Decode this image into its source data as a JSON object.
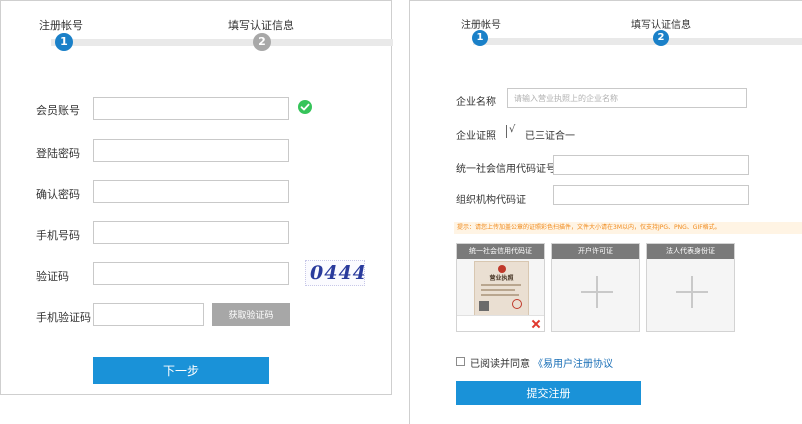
{
  "left": {
    "steps": [
      {
        "label": "注册帐号",
        "number": "1"
      },
      {
        "label": "填写认证信息",
        "number": "2"
      }
    ],
    "fields": {
      "account_label": "会员账号",
      "password_label": "登陆密码",
      "confirm_label": "确认密码",
      "phone_label": "手机号码",
      "captcha_label": "验证码",
      "sms_label": "手机验证码"
    },
    "captcha_text": "0444",
    "get_code_button": "获取验证码",
    "next_button": "下一步"
  },
  "right": {
    "steps": [
      {
        "label": "注册帐号",
        "number": "1"
      },
      {
        "label": "填写认证信息",
        "number": "2"
      }
    ],
    "company_name_label": "企业名称",
    "company_name_placeholder": "请输入营业执照上的企业名称",
    "certificate_label": "企业证照",
    "certificate_value": "已三证合一",
    "credit_code_label": "统一社会信用代码证号",
    "org_code_label": "组织机构代码证",
    "notice": "提示：请您上传加盖公章的证照彩色扫描件，文件大小请在3M以内，仅支持JPG、PNG、GIF格式。",
    "uploads": [
      {
        "title": "统一社会信用代码证"
      },
      {
        "title": "开户许可证"
      },
      {
        "title": "法人代表身份证"
      }
    ],
    "license_title": "营业执照",
    "agree_prefix": "已阅读并同意",
    "agree_link": "《易用户注册协议",
    "submit_button": "提交注册"
  },
  "colors": {
    "primary": "#1a92d8",
    "step_active": "#1a80c8",
    "step_inactive": "#a8a8a8",
    "success": "#36c45a",
    "notice_text": "#f08a1c",
    "notice_bg": "#fff4e4",
    "delete": "#e0382d"
  }
}
